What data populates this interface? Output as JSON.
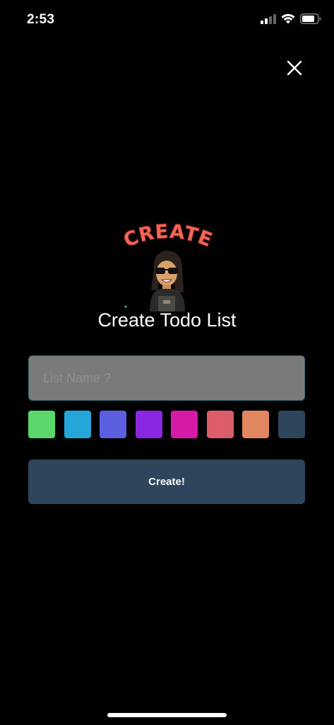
{
  "status_bar": {
    "time": "2:53",
    "signal_icon": "cellular-signal-icon",
    "wifi_icon": "wifi-icon",
    "battery_icon": "battery-icon"
  },
  "close_icon": "close-icon",
  "sticker": {
    "text": "CREATE",
    "text_color": "#ef6a5a"
  },
  "title": "Create Todo List",
  "input": {
    "placeholder": "List Name ?",
    "value": ""
  },
  "colors": [
    "#5bd86b",
    "#24a6d9",
    "#5c5fe0",
    "#8a27e0",
    "#d51aa7",
    "#dc5d6a",
    "#e0875f",
    "#2f455c"
  ],
  "create_button": {
    "label": "Create!",
    "color": "#2f455c"
  }
}
